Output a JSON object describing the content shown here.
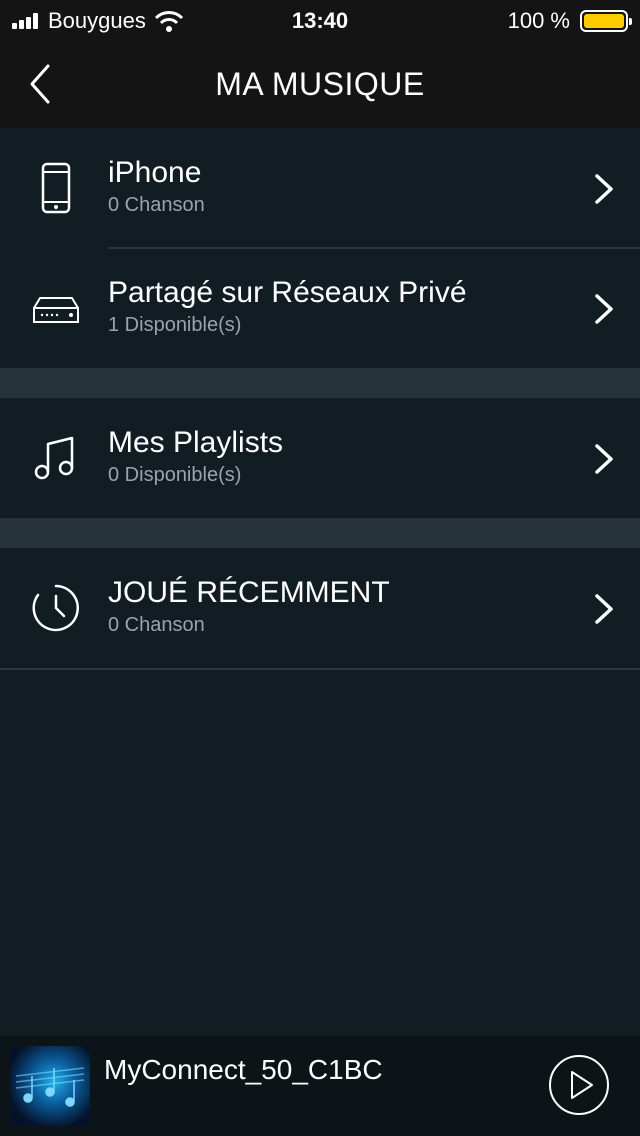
{
  "status_bar": {
    "carrier": "Bouygues",
    "time": "13:40",
    "battery_percent": "100 %",
    "battery_level": 1.0,
    "battery_color": "#ffcc00"
  },
  "header": {
    "title": "MA MUSIQUE",
    "back_icon": "chevron-left-icon"
  },
  "sources": [
    {
      "title": "iPhone",
      "subtitle": "0 Chanson",
      "icon": "phone-icon"
    },
    {
      "title": "Partagé sur Réseaux Privé",
      "subtitle": "1 Disponible(s)",
      "icon": "network-device-icon"
    }
  ],
  "playlists": {
    "title": "Mes Playlists",
    "subtitle": "0 Disponible(s)",
    "icon": "music-note-icon"
  },
  "recent": {
    "title": "JOUÉ RÉCEMMENT",
    "subtitle": "0 Chanson",
    "icon": "clock-icon"
  },
  "player": {
    "device_name": "MyConnect_50_C1BC",
    "play_icon": "play-icon"
  },
  "colors": {
    "background": "#131c22",
    "bar": "#141414",
    "section_gap": "#26323a",
    "subtitle": "#9aa3a8"
  }
}
